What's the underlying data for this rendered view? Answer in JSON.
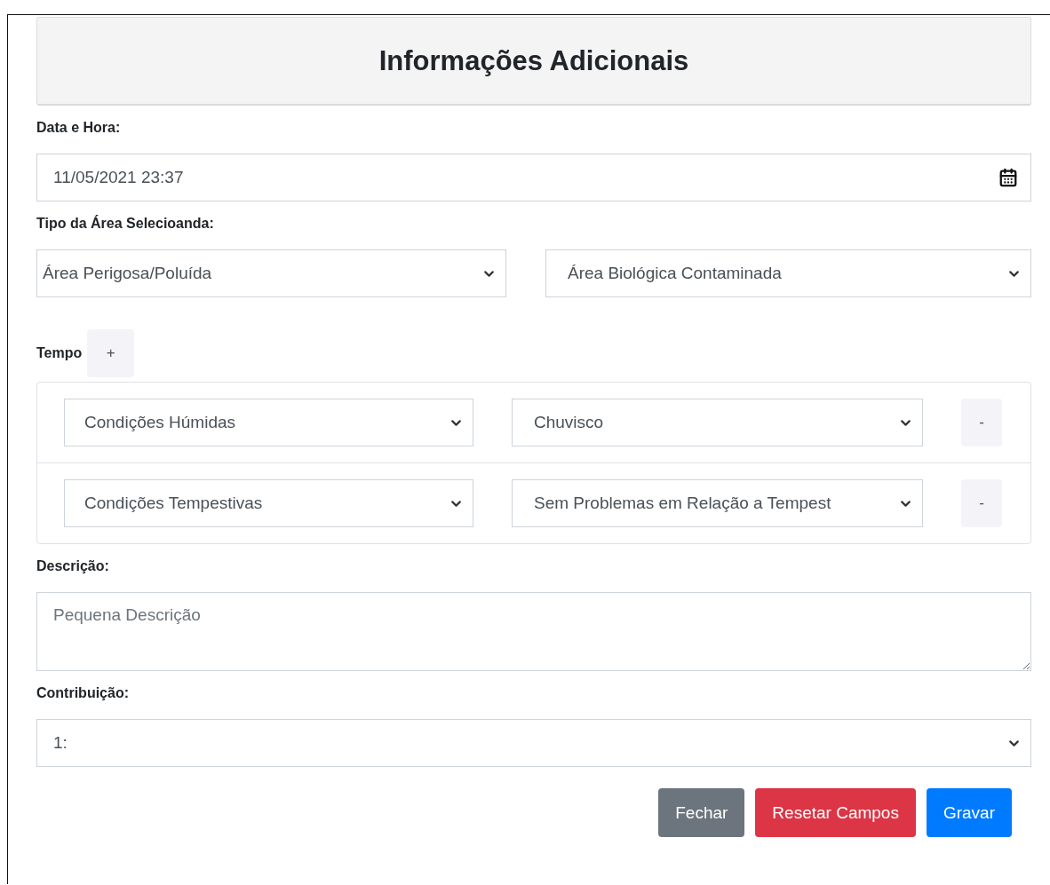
{
  "title": "Informações Adicionais",
  "datetime": {
    "label": "Data e Hora:",
    "value": "11/05/2021 23:37"
  },
  "area_type": {
    "label": "Tipo da Área Selecioanda:",
    "selects": [
      "Área Perigosa/Poluída",
      "Área Biológica Contaminada"
    ]
  },
  "weather": {
    "label": "Tempo",
    "add_button": "+",
    "rows": [
      {
        "category": "Condições Húmidas",
        "condition": "Chuvisco",
        "remove_button": "-"
      },
      {
        "category": "Condições Tempestivas",
        "condition": "Sem Problemas em Relação a Tempest",
        "remove_button": "-"
      }
    ]
  },
  "description": {
    "label": "Descrição:",
    "placeholder": "Pequena Descrição"
  },
  "contribution": {
    "label": "Contribuição:",
    "value": "1:"
  },
  "buttons": [
    {
      "label": "Fechar",
      "kind": "secondary"
    },
    {
      "label": "Resetar Campos",
      "kind": "danger"
    },
    {
      "label": "Gravar",
      "kind": "primary"
    }
  ]
}
